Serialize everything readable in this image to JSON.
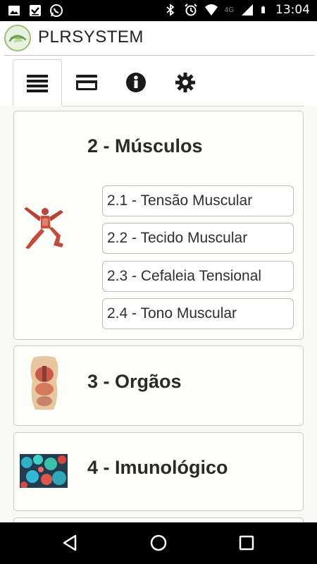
{
  "status_bar": {
    "time": "13:04",
    "network": "4G",
    "left_icons": [
      "image-icon",
      "download-done-icon",
      "whatsapp-icon"
    ],
    "right_icons": [
      "bluetooth-icon",
      "alarm-icon",
      "wifi-icon",
      "signal-icon",
      "battery-icon"
    ]
  },
  "app": {
    "title": "PLRSYSTEM",
    "logo_icon": "app-logo"
  },
  "tabs": [
    {
      "icon": "list-icon",
      "active": true
    },
    {
      "icon": "card-icon",
      "active": false
    },
    {
      "icon": "info-icon",
      "active": false
    },
    {
      "icon": "gear-icon",
      "active": false
    }
  ],
  "sections": [
    {
      "title": "2 - Músculos",
      "image": "muscle-figure-image",
      "items": [
        "2.1 - Tensão Muscular",
        "2.2 - Tecido Muscular",
        "2.3 - Cefaleia Tensional",
        "2.4 - Tono Muscular"
      ]
    },
    {
      "title": "3 - Orgãos",
      "image": "organs-torso-image",
      "items": []
    },
    {
      "title": "4 - Imunológico",
      "image": "immune-cells-image",
      "items": []
    }
  ],
  "nav_bar": {
    "buttons": [
      "back-icon",
      "home-icon",
      "recents-icon"
    ]
  },
  "colors": {
    "accent_logo": "#9cc07a",
    "card_bg": "#fdfdf9",
    "content_bg": "#f8f8f6"
  }
}
